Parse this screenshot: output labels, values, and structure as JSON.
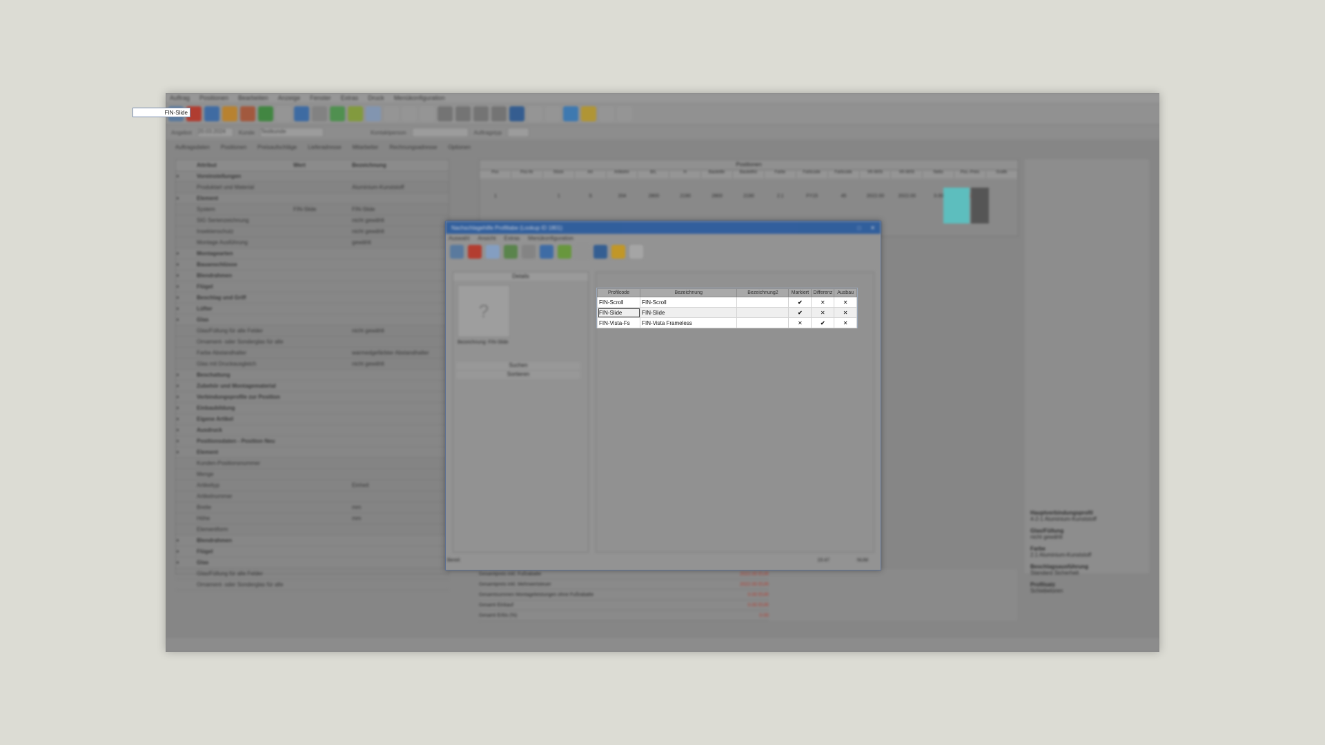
{
  "app": {
    "menu": [
      "Auftrag",
      "Positionen",
      "Bearbeiten",
      "Anzeige",
      "Fenster",
      "Extras",
      "Druck",
      "Menükonfiguration"
    ],
    "tabs": [
      "Auftragsdaten",
      "Positionen",
      "Preisaufschläge",
      "Lieferadresse",
      "Mitarbeiter",
      "Rechnungsadresse",
      "Optionen"
    ],
    "header": {
      "label_offer": "Angebot",
      "date": "20.03.2024",
      "label_customer": "Kunde",
      "customer": "Testkunde",
      "label_person": "Kontaktperson",
      "label_project": "Auftragstyp"
    }
  },
  "grid": {
    "header": [
      "Attribut",
      "Wert",
      "Bezeichnung"
    ],
    "rows": [
      {
        "name": "Voreinstellungen",
        "value": "",
        "desc": "",
        "group": true
      },
      {
        "name": "Produktart und Material",
        "value": "",
        "desc": "Aluminium-Kunststoff",
        "group": false
      },
      {
        "name": "Element",
        "value": "",
        "desc": "",
        "group": true
      },
      {
        "name": "System",
        "value": "FIN-Slide",
        "desc": "FIN-Slide",
        "group": false
      },
      {
        "name": "SIG Serienzeichnung",
        "value": "",
        "desc": "nicht gewählt",
        "group": false
      },
      {
        "name": "Insektenschutz",
        "value": "",
        "desc": "nicht gewählt",
        "group": false
      },
      {
        "name": "Montage Ausführung",
        "value": "",
        "desc": "gewählt",
        "group": false
      },
      {
        "name": "Montagearten",
        "value": "",
        "desc": "",
        "group": true
      },
      {
        "name": "Bauanschlüsse",
        "value": "",
        "desc": "",
        "group": true
      },
      {
        "name": "Blendrahmen",
        "value": "",
        "desc": "",
        "group": true
      },
      {
        "name": "Flügel",
        "value": "",
        "desc": "",
        "group": true
      },
      {
        "name": "Beschlag und Griff",
        "value": "",
        "desc": "",
        "group": true
      },
      {
        "name": "Lüfter",
        "value": "",
        "desc": "",
        "group": true
      },
      {
        "name": "Glas",
        "value": "",
        "desc": "",
        "group": true
      },
      {
        "name": "Glas/Füllung für alle Felder",
        "value": "",
        "desc": "nicht gewählt",
        "group": false
      },
      {
        "name": "Ornament- oder Sonderglas für alle",
        "value": "",
        "desc": "",
        "group": false
      },
      {
        "name": "Farbe Abstandhalter",
        "value": "",
        "desc": "warmedgefärbter Abstandhalter",
        "group": false
      },
      {
        "name": "Glas mit Druckausgleich",
        "value": "",
        "desc": "nicht gewählt",
        "group": false
      },
      {
        "name": "Beschattung",
        "value": "",
        "desc": "",
        "group": true
      },
      {
        "name": "Zubehör und Montagematerial",
        "value": "",
        "desc": "",
        "group": true
      },
      {
        "name": "Verbindungsprofile zur Position",
        "value": "",
        "desc": "",
        "group": true
      },
      {
        "name": "Einbaubildung",
        "value": "",
        "desc": "",
        "group": true
      },
      {
        "name": "Eigene Artikel",
        "value": "",
        "desc": "",
        "group": true
      },
      {
        "name": "Ausdruck",
        "value": "",
        "desc": "",
        "group": true
      },
      {
        "name": "Positionsdaten - Position Neu",
        "value": "",
        "desc": "",
        "group": true
      },
      {
        "name": "Element",
        "value": "",
        "desc": "",
        "group": true
      },
      {
        "name": "Kunden-Positionsnummer",
        "value": "",
        "desc": "",
        "group": false
      },
      {
        "name": "Menge",
        "value": "",
        "desc": "",
        "group": false
      },
      {
        "name": "Artikeltyp",
        "value": "",
        "desc": "Einheit",
        "group": false
      },
      {
        "name": "Artikelnummer",
        "value": "",
        "desc": "",
        "group": false
      },
      {
        "name": "Breite",
        "value": "",
        "desc": "mm",
        "group": false
      },
      {
        "name": "Höhe",
        "value": "",
        "desc": "mm",
        "group": false
      },
      {
        "name": "Elementform",
        "value": "",
        "desc": "",
        "group": false
      },
      {
        "name": "Blendrahmen",
        "value": "",
        "desc": "",
        "group": true
      },
      {
        "name": "Flügel",
        "value": "",
        "desc": "",
        "group": true
      },
      {
        "name": "Glas",
        "value": "",
        "desc": "",
        "group": true
      },
      {
        "name": "Glas/Füllung für alle Felder",
        "value": "",
        "desc": "",
        "group": false
      },
      {
        "name": "Ornament- oder Sonderglas für alle",
        "value": "",
        "desc": "",
        "group": false
      }
    ]
  },
  "system_cell_value": "FIN-Slide",
  "positions": {
    "title": "Positionen",
    "header": [
      "Pos",
      "Pos-Nr",
      "Stück",
      "Art",
      "Artikelnr",
      "B/L",
      "H",
      "Bauteilbr",
      "Bauteilhö",
      "Farbe",
      "Farbcode",
      "Farbcode",
      "VK-M/St",
      "VK-M/St",
      "Netto",
      "Pos.-Preis",
      "Grafik"
    ],
    "row": [
      "1",
      "",
      "1",
      "S",
      "204",
      "2800",
      "2190",
      "2800",
      "2190",
      "2.1",
      "FY15",
      "45",
      "2022.00",
      "2022.00",
      "0.00",
      "2022.00"
    ]
  },
  "dialog": {
    "title": "Nachschlagehilfe Profiltabe (Lookup ID 1801)",
    "menu": [
      "Auswahl",
      "Ansicht",
      "Extras",
      "Menükonfiguration"
    ],
    "details_label": "Details",
    "preview_caption": "Bezeichnung: FIN-Slide",
    "search_label": "Suchen",
    "sort_label": "Sortieren",
    "status_left": "Bereit",
    "status_time": "15:47",
    "status_mode": "NUM"
  },
  "lookup": {
    "columns": [
      "Profilcode",
      "Bezeichnung",
      "Bezeichnung2",
      "Markiert",
      "Differenz",
      "Ausbau"
    ],
    "rows": [
      {
        "code": "FIN-Scroll",
        "name": "FIN-Scroll",
        "name2": "",
        "marked": true,
        "diff": false,
        "out": false
      },
      {
        "code": "FIN-Slide",
        "name": "FIN-Slide",
        "name2": "",
        "marked": true,
        "diff": false,
        "out": false
      },
      {
        "code": "FIN-Vista-Fs",
        "name": "FIN-Vista Frameless",
        "name2": "",
        "marked": false,
        "diff": true,
        "out": false
      }
    ]
  },
  "summary": [
    {
      "label": "Gesamtpreis inkl. Fußrabatte",
      "value": "2022.00 EUR"
    },
    {
      "label": "Gesamtpreis inkl. Mehrwertsteuer",
      "value": "2022.00 EUR"
    },
    {
      "label": "Gesamtsummen Montageleistungen ohne Fußrabatte",
      "value": "0.00 EUR"
    },
    {
      "label": "Gesamt Einkauf",
      "value": "0.00 EUR"
    },
    {
      "label": "Gesamt Erlös (%)",
      "value": "0.00"
    }
  ],
  "info_panel": {
    "sections": [
      {
        "title": "Hauptverbindungsprofil",
        "text": "4-2-1 Aluminium-Kunststoff"
      },
      {
        "title": "Glas/Füllung",
        "text": "nicht gewählt"
      },
      {
        "title": "Farbe",
        "text": "2.1 Aluminium-Kunststoff"
      },
      {
        "title": "Beschlagsausführung",
        "text": "Standard Sicherheit"
      },
      {
        "title": "Profilsatz",
        "text": "Schiebetüren"
      }
    ]
  },
  "colors": {
    "accent": "#215aa8",
    "price_red": "#c0392b",
    "preview_glass": "#5fd0d0",
    "preview_frame": "#555555"
  }
}
